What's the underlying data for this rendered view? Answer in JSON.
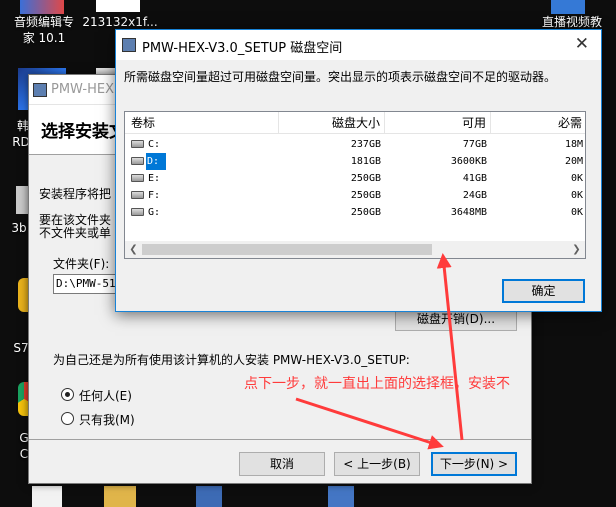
{
  "desktop": {
    "icons": [
      {
        "label_lines": [
          "音频编辑专",
          "家 10.1"
        ]
      },
      {
        "label_lines": [
          "213132x1f..."
        ]
      },
      {
        "label_lines": [
          "直播视频教"
        ]
      },
      {
        "label_lines": [
          "韩"
        ]
      },
      {
        "label_lines": [
          "RD"
        ]
      },
      {
        "label_lines": [
          "3b"
        ]
      },
      {
        "label_lines": [
          "S7"
        ]
      },
      {
        "label_lines": [
          "G"
        ]
      },
      {
        "label_lines": [
          "C"
        ]
      }
    ]
  },
  "installer": {
    "window_title": "PMW-HEX",
    "header_title": "选择安装文",
    "text_line1": "安装程序将把",
    "text_line2": "要在该文件夹",
    "text_line3": "不文件夹或单",
    "folder_label": "文件夹(F):",
    "folder_value": "D:\\PMW-51H",
    "disk_cost_button": "磁盘开销(D)...",
    "install_for_text": "为自己还是为所有使用该计算机的人安装 PMW-HEX-V3.0_SETUP:",
    "radio_everyone": "任何人(E)",
    "radio_only_me": "只有我(M)",
    "cancel_button": "取消",
    "back_button": "< 上一步(B)",
    "next_button": "下一步(N) >"
  },
  "disk_dialog": {
    "title": "PMW-HEX-V3.0_SETUP 磁盘空间",
    "message": "所需磁盘空间量超过可用磁盘空间量。突出显示的项表示磁盘空间不足的驱动器。",
    "columns": [
      "卷标",
      "磁盘大小",
      "可用",
      "必需"
    ],
    "rows": [
      {
        "volume": "C:",
        "size": "237GB",
        "available": "77GB",
        "required": "18M",
        "selected": false
      },
      {
        "volume": "D:",
        "size": "181GB",
        "available": "3600KB",
        "required": "20M",
        "selected": true
      },
      {
        "volume": "E:",
        "size": "250GB",
        "available": "41GB",
        "required": "0K",
        "selected": false
      },
      {
        "volume": "F:",
        "size": "250GB",
        "available": "24GB",
        "required": "0K",
        "selected": false
      },
      {
        "volume": "G:",
        "size": "250GB",
        "available": "3648MB",
        "required": "0K",
        "selected": false
      }
    ],
    "ok_button": "确定"
  },
  "annotation": {
    "text": "点下一步，就一直出上面的选择框，安装不",
    "color": "#ff3b3b"
  },
  "colors": {
    "accent": "#0078d7",
    "annotation_red": "#ff3b3b"
  }
}
